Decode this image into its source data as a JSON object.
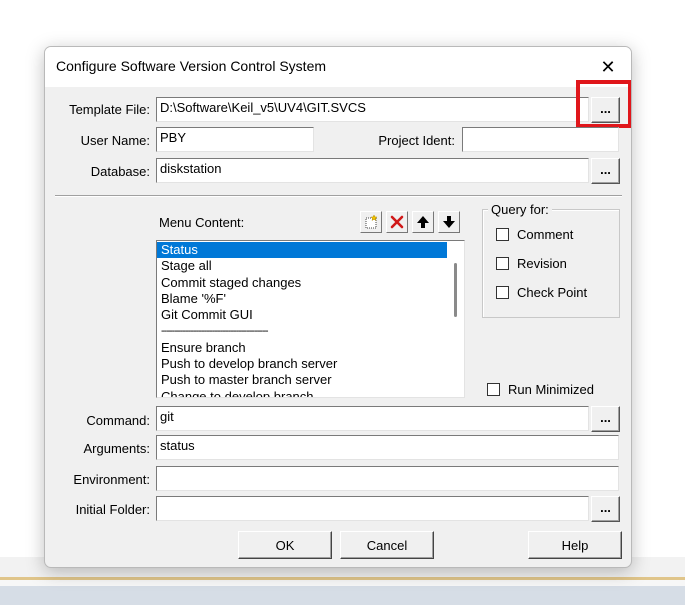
{
  "dialog": {
    "title": "Configure Software Version Control System",
    "close_icon": "close-icon"
  },
  "fields": {
    "template_file": {
      "label": "Template File:",
      "value": "D:\\Software\\Keil_v5\\UV4\\GIT.SVCS"
    },
    "user_name": {
      "label": "User Name:",
      "value": "PBY"
    },
    "project_ident": {
      "label": "Project Ident:",
      "value": ""
    },
    "database": {
      "label": "Database:",
      "value": "diskstation"
    },
    "command": {
      "label": "Command:",
      "value": "git"
    },
    "arguments": {
      "label": "Arguments:",
      "value": "status"
    },
    "environment": {
      "label": "Environment:",
      "value": ""
    },
    "initial_folder": {
      "label": "Initial Folder:",
      "value": ""
    }
  },
  "browse_label": "...",
  "menu": {
    "label": "Menu Content:",
    "toolbar_icons": [
      "new-item-icon",
      "delete-icon",
      "move-up-icon",
      "move-down-icon"
    ],
    "items": [
      "Status",
      "Stage all",
      "Commit staged changes",
      "Blame '%F'",
      "Git Commit GUI",
      "----------------------------------------",
      "Ensure branch",
      "Push to develop branch server",
      "Push to master branch server",
      "Change to develop branch"
    ],
    "selected_index": 0
  },
  "query": {
    "title": "Query for:",
    "options": [
      {
        "label": "Comment",
        "checked": false
      },
      {
        "label": "Revision",
        "checked": false
      },
      {
        "label": "Check Point",
        "checked": false
      }
    ]
  },
  "run_minimized": {
    "label": "Run Minimized",
    "checked": false
  },
  "buttons": {
    "ok": "OK",
    "cancel": "Cancel",
    "help": "Help"
  },
  "colors": {
    "highlight_box": "#e0161b",
    "selection": "#0078d7"
  }
}
